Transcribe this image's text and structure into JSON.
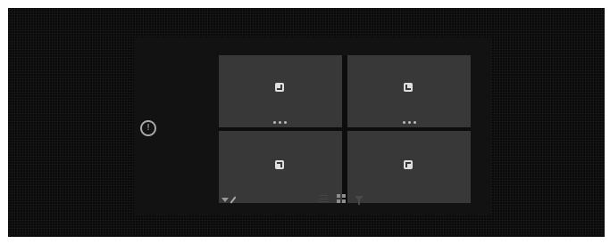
{
  "stage": {
    "background": "#0b0b0b"
  },
  "panel": {
    "background": "#121212"
  },
  "info": {
    "icon": "info-icon",
    "glyph": "!"
  },
  "tiles": [
    {
      "position": "top-left",
      "icon": "snap-top-left-icon"
    },
    {
      "position": "top-right",
      "icon": "snap-top-right-icon"
    },
    {
      "position": "bottom-left",
      "icon": "snap-bottom-left-icon"
    },
    {
      "position": "bottom-right",
      "icon": "snap-bottom-right-icon"
    }
  ],
  "toolbar": {
    "left": [
      "chevron-down-icon",
      "pencil-icon"
    ],
    "right": [
      "list-icon",
      "grid-icon",
      "filter-icon"
    ]
  },
  "colors": {
    "tile": "#383838",
    "icon": "#dedede",
    "muted": "#9a9a9a"
  }
}
